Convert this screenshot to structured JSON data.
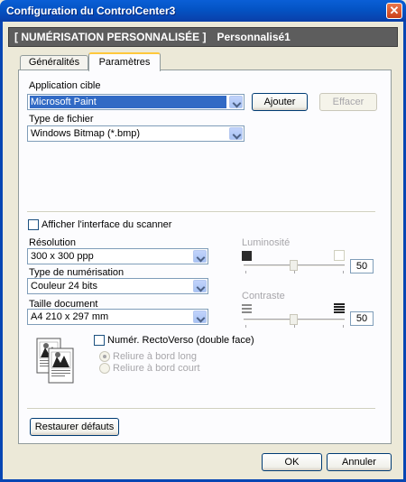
{
  "window": {
    "title": "Configuration du ControlCenter3",
    "close_glyph": "✕"
  },
  "header": {
    "left": "[ NUMÉRISATION PERSONNALISÉE ]",
    "right": "Personnalisé1"
  },
  "tabs": [
    {
      "label": "Généralités"
    },
    {
      "label": "Paramètres"
    }
  ],
  "target_app": {
    "label": "Application cible",
    "value": "Microsoft Paint",
    "add_button": "Ajouter",
    "delete_button": "Effacer"
  },
  "file_type": {
    "label": "Type de fichier",
    "value": "Windows Bitmap (*.bmp)"
  },
  "show_scanner_ui": {
    "label": "Afficher l'interface du scanner",
    "checked": false
  },
  "resolution": {
    "label": "Résolution",
    "value": "300 x 300 ppp"
  },
  "scan_type": {
    "label": "Type de numérisation",
    "value": "Couleur 24 bits"
  },
  "doc_size": {
    "label": "Taille document",
    "value": "A4 210 x 297 mm"
  },
  "duplex": {
    "label": "Numér. RectoVerso (double face)",
    "checked": false,
    "long_edge": "Reliure à bord long",
    "short_edge": "Reliure à bord court"
  },
  "brightness": {
    "label": "Luminosité",
    "value": "50",
    "level": 0.5
  },
  "contrast": {
    "label": "Contraste",
    "value": "50",
    "level": 0.5
  },
  "restore_defaults": "Restaurer défauts",
  "ok_button": "OK",
  "cancel_button": "Annuler",
  "icons": [
    "duplex-page-icon",
    "brightness-dark-icon",
    "brightness-light-icon",
    "contrast-low-icon",
    "contrast-high-icon",
    "chevron-down-icon"
  ]
}
